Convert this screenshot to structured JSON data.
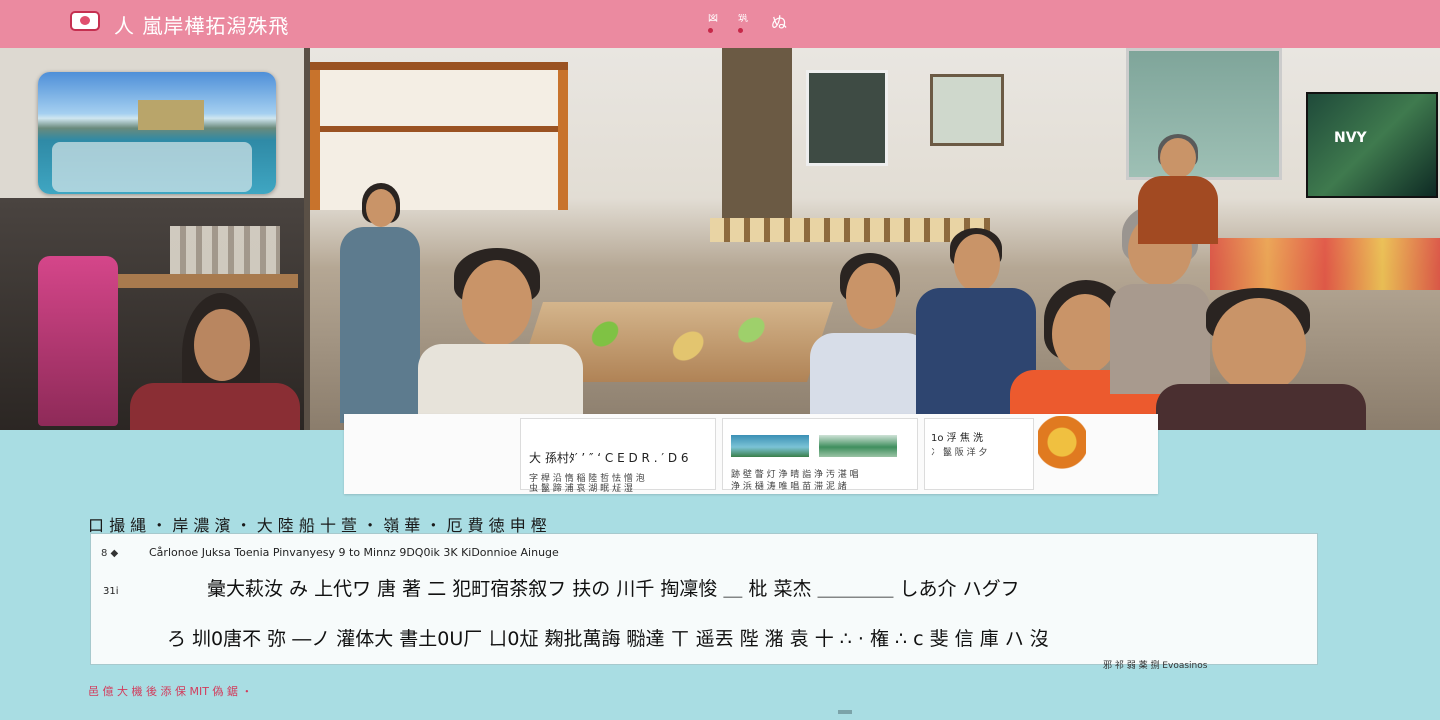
{
  "header": {
    "site_title": "人 嵐岸樺拓潟殊飛",
    "nav": [
      "図",
      "筑",
      "ぬ"
    ],
    "logo_icon": "camera-logo-icon"
  },
  "hero": {
    "wall_sign": "NVY",
    "landscape_icon": "landscape-photo"
  },
  "preview": {
    "card1_title": "大 孫村ﾀ′ ’ ″ ‘ C E D R . ′ D 6",
    "card1_sub1": "字 桿 沿 惰 稲 陸 哲 怯 憎 泡",
    "card1_sub2": "虫 鬣 蹄 浦 哀 湖 眠 ㍽ 湿",
    "card2_sub1": "跡 壁 瞥 灯 浄 晴 詣 浄 汚 湛 唱",
    "card2_sub2": "浄 浜 樋 涛 唯 唱 苗 滞 泥 諸",
    "card3_title": "1o 浮 焦 洗",
    "card3_sub": "冫 鬣 阪 洋 夕"
  },
  "breadcrumb": "口 撮 縄 ・ 岸 濃 濱 ・ 大 陸 船 十 萱 ・ 嶺 華 ・ 厄 費 徳 申 樫",
  "content": {
    "icon_label": "8 ◆",
    "meta": "Cårlonoe Juksa Toenia Pinvanyesy 9 to Minnz 9DQ0ik 3K KiDonnioe Ainuge",
    "side_label": "31i",
    "line1": "彙大萩汝 み    上代ワ 唐 著 二 犯町宿茶叙フ 扶の 川千 掏凜悛 ＿ 枇  菜杰 ＿＿＿＿ しあ介 ハグフ",
    "line2": "ろ 圳0唐不 弥 ―ノ 灌体大 書土0U厂 ㄩ0㍽ 麹批萬誨 ㍾達 ㄒ 遥丟 陛 潴 袁  十 ∴ ·  権 ∴ c 斐 信 庫 ハ 沒",
    "footer": "邪 祁 弱 薬 捌 Evoasinos"
  },
  "footer_link": "邑 億 大 機 後 添 保 MIT 偽 鋸 ・",
  "colors": {
    "topbar": "#eb8aa0",
    "background": "#a9dde3",
    "accent_red": "#d23c5c"
  }
}
